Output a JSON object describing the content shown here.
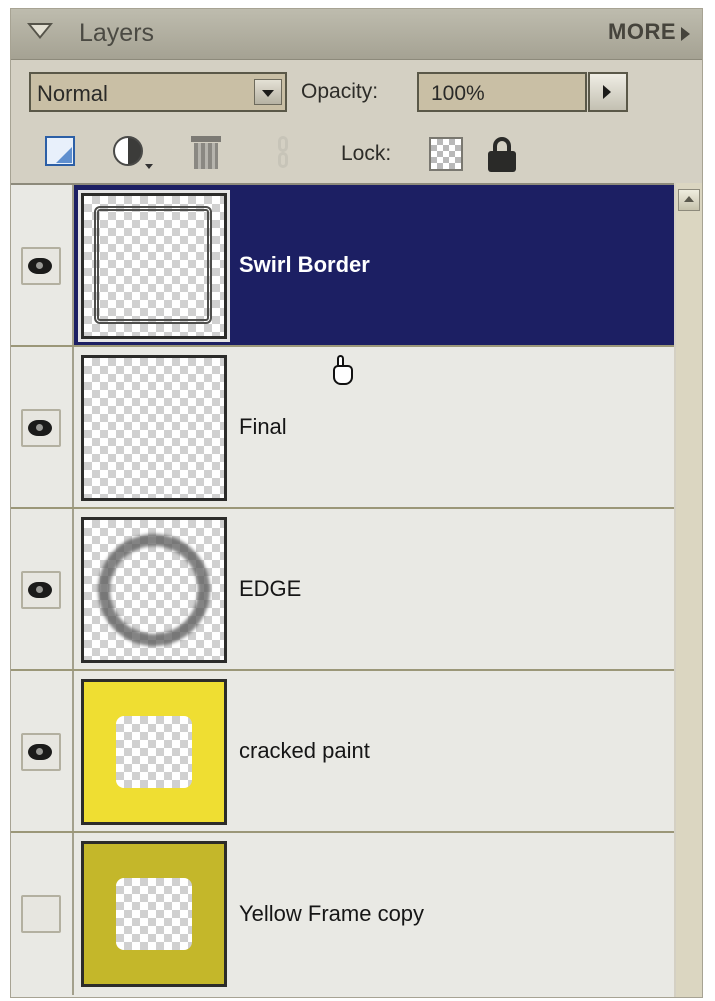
{
  "header": {
    "title": "Layers",
    "more_label": "MORE"
  },
  "controls": {
    "blend_mode": "Normal",
    "opacity_label": "Opacity:",
    "opacity_value": "100%",
    "lock_label": "Lock:"
  },
  "toolbar": {
    "icons": [
      "new-layer-icon",
      "adjustment-layer-icon",
      "trash-icon",
      "link-icon",
      "lock-transparent-icon",
      "lock-all-icon"
    ]
  },
  "layers": [
    {
      "name": "Swirl Border",
      "visible": true,
      "selected": true,
      "thumb": "swirl-border"
    },
    {
      "name": "Final",
      "visible": true,
      "selected": false,
      "thumb": "transparent"
    },
    {
      "name": "EDGE",
      "visible": true,
      "selected": false,
      "thumb": "edge"
    },
    {
      "name": "cracked paint",
      "visible": true,
      "selected": false,
      "thumb": "yellow-frame"
    },
    {
      "name": "Yellow Frame copy",
      "visible": false,
      "selected": false,
      "thumb": "olive-frame"
    }
  ],
  "colors": {
    "selection": "#1c1f63",
    "panel": "#d4d0c3",
    "list_bg": "#e9e9e4",
    "yellow": "#efde32",
    "olive": "#c4b72a"
  }
}
